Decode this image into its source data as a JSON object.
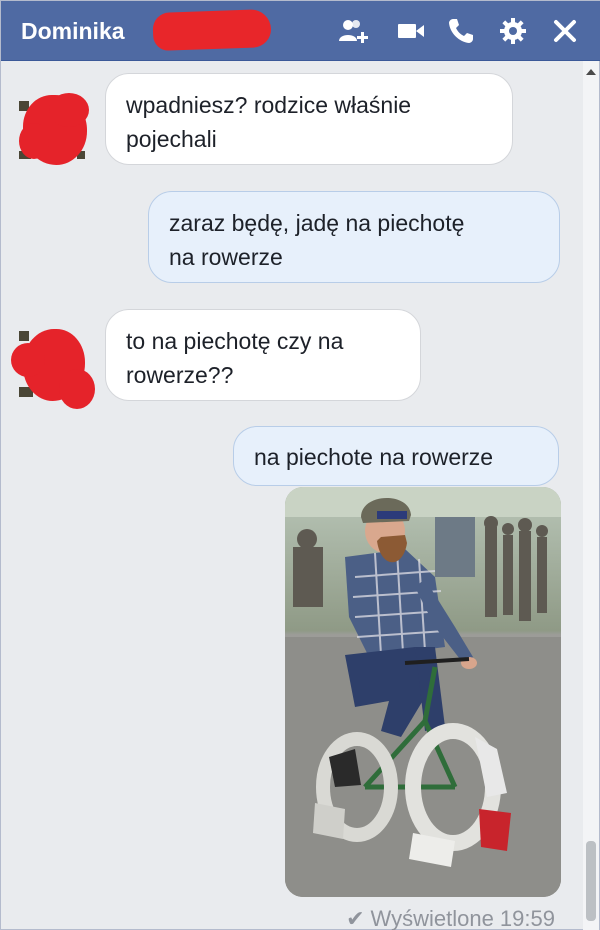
{
  "header": {
    "contact_name": "Dominika",
    "icons": [
      "add-friend-icon",
      "video-call-icon",
      "phone-icon",
      "gear-icon",
      "close-icon"
    ]
  },
  "messages": [
    {
      "direction": "incoming",
      "text": "wpadniesz? rodzice właśnie\npojechali"
    },
    {
      "direction": "outgoing",
      "text": "zaraz będę, jadę na piechotę\nna rowerze"
    },
    {
      "direction": "incoming",
      "text": "to na piechotę czy na\nrowerze??"
    },
    {
      "direction": "outgoing",
      "text": "na piechote na rowerze"
    },
    {
      "direction": "outgoing",
      "type": "image"
    }
  ],
  "receipt": {
    "label": "Wyświetlone 19:59"
  },
  "colors": {
    "header": "#4f6aa3",
    "incoming_bubble": "#ffffff",
    "outgoing_bubble": "#e7f0fb",
    "redaction": "#e8262a",
    "background": "#e9ebee"
  }
}
